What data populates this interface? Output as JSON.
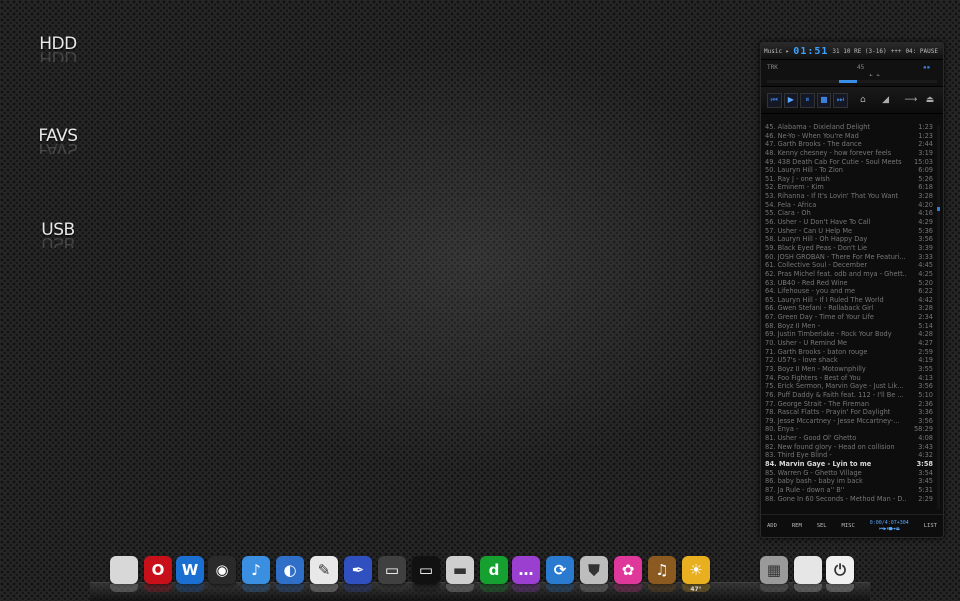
{
  "desktop": {
    "drives": [
      {
        "label": "HDD"
      },
      {
        "label": "FAVS"
      },
      {
        "label": "USB"
      }
    ]
  },
  "player": {
    "top_left": "Music ▸",
    "time": "01:51",
    "format": "31 10 RE (3-16)",
    "mode": "+++",
    "info_right": "04: PAUSE",
    "info_a": "TRK",
    "info_b": "45",
    "playlist": [
      {
        "title": "45. Alabama - Dixieland Delight",
        "time": "1:23"
      },
      {
        "title": "46. Ne-Yo - When You're Mad",
        "time": "1:23"
      },
      {
        "title": "47. Garth Brooks - The dance",
        "time": "2:44"
      },
      {
        "title": "48. Kenny chesney - how forever feels",
        "time": "3:19"
      },
      {
        "title": "49. 438 Death Cab For Cutie - Soul Meets",
        "time": "15:03"
      },
      {
        "title": "50. Lauryn Hill - To Zion",
        "time": "6:09"
      },
      {
        "title": "51. Ray J - one wish",
        "time": "5:26"
      },
      {
        "title": "52. Eminem - Kim",
        "time": "6:18"
      },
      {
        "title": "53. Rihanna - If It's Lovin' That You Want",
        "time": "3:28"
      },
      {
        "title": "54. Fela - Africa",
        "time": "4:20"
      },
      {
        "title": "55. Ciara - Oh",
        "time": "4:16"
      },
      {
        "title": "56. Usher - U Don't Have To Call",
        "time": "4:29"
      },
      {
        "title": "57. Usher - Can U Help Me",
        "time": "5:36"
      },
      {
        "title": "58. Lauryn Hill - Oh Happy Day",
        "time": "3:56"
      },
      {
        "title": "59. Black Eyed Peas - Don't Lie",
        "time": "3:39"
      },
      {
        "title": "60. JOSH GROBAN - There For Me Featuri...",
        "time": "3:33"
      },
      {
        "title": "61. Collective Soul - December",
        "time": "4:45"
      },
      {
        "title": "62. Pras Michel feat. odb and mya - Ghett...",
        "time": "4:25"
      },
      {
        "title": "63. UB40 - Red Red Wine",
        "time": "5:20"
      },
      {
        "title": "64. Lifehouse - you and me",
        "time": "6:22"
      },
      {
        "title": "65. Lauryn Hill - If I Ruled The World",
        "time": "4:42"
      },
      {
        "title": "66. Gwen Stefani - Rollaback Girl",
        "time": "3:28"
      },
      {
        "title": "67. Green Day - Time of Your Life",
        "time": "2:34"
      },
      {
        "title": "68. Boyz II Men -",
        "time": "5:14"
      },
      {
        "title": "69. Justin Timberlake - Rock Your Body",
        "time": "4:28"
      },
      {
        "title": "70. Usher - U Remind Me",
        "time": "4:27"
      },
      {
        "title": "71. Garth Brooks - baton rouge",
        "time": "2:59"
      },
      {
        "title": "72. U57's - love shack",
        "time": "4:19"
      },
      {
        "title": "73. Boyz II Men - Motownphilly",
        "time": "3:55"
      },
      {
        "title": "74. Foo Fighters - Best of You",
        "time": "4:13"
      },
      {
        "title": "75. Erick Sermon, Marvin Gaye - Just Lik...",
        "time": "3:56"
      },
      {
        "title": "76. Puff Daddy & Faith feat. 112 - I'll Be ...",
        "time": "5:10"
      },
      {
        "title": "77. George Strait - The Fireman",
        "time": "2:36"
      },
      {
        "title": "78. Rascal Flatts - Prayin' For Daylight",
        "time": "3:36"
      },
      {
        "title": "79. Jesse Mccartney - Jesse Mccartney-...",
        "time": "3:56"
      },
      {
        "title": "80. Enya -",
        "time": "58:29"
      },
      {
        "title": "81. Usher - Good Ol' Ghetto",
        "time": "4:08"
      },
      {
        "title": "82. New found glory - Head on collision",
        "time": "3:43"
      },
      {
        "title": "83. Third Eye Blind -",
        "time": "4:32"
      },
      {
        "title": "84. Marvin Gaye - Lyin to me",
        "time": "3:58"
      },
      {
        "title": "85. Warren G - Ghetto Village",
        "time": "3:54"
      },
      {
        "title": "86. baby bash - baby im back",
        "time": "3:45"
      },
      {
        "title": "87. Ja Rule - down a'' B''",
        "time": "5:31"
      },
      {
        "title": "88. Gone In 60 Seconds - Method Man - D...",
        "time": "2:29"
      }
    ],
    "active_index": 39,
    "bottom": {
      "add": "ADD",
      "rem": "REM",
      "sel": "SEL",
      "misc": "MISC",
      "counter": "0:00/4:07+304",
      "list": "LIST"
    }
  },
  "dock": {
    "weather_temp": "47°",
    "items": [
      {
        "name": "mouse-icon",
        "glyph": "",
        "bg": "#d8d8d8"
      },
      {
        "name": "opera-icon",
        "glyph": "O",
        "bg": "#c8101a"
      },
      {
        "name": "wordpad-icon",
        "glyph": "W",
        "bg": "#1b6fd0"
      },
      {
        "name": "camera-icon",
        "glyph": "◉",
        "bg": "#2a2a2a"
      },
      {
        "name": "itunes-icon",
        "glyph": "♪",
        "bg": "#3a8fe0"
      },
      {
        "name": "firefox-icon",
        "glyph": "◐",
        "bg": "#2f6fc8"
      },
      {
        "name": "feather-icon",
        "glyph": "✎",
        "bg": "#e8e8e8"
      },
      {
        "name": "pen-icon",
        "glyph": "✒",
        "bg": "#3050c0"
      },
      {
        "name": "monitor-icon",
        "glyph": "▭",
        "bg": "#404040"
      },
      {
        "name": "display-icon",
        "glyph": "▭",
        "bg": "#111111"
      },
      {
        "name": "drive-icon",
        "glyph": "▬",
        "bg": "#cfcfcf"
      },
      {
        "name": "dreamweaver-icon",
        "glyph": "d",
        "bg": "#16a030"
      },
      {
        "name": "pidgin-icon",
        "glyph": "…",
        "bg": "#9a3fcf"
      },
      {
        "name": "sync-icon",
        "glyph": "⟳",
        "bg": "#2a7ad0"
      },
      {
        "name": "shield-icon",
        "glyph": "⛊",
        "bg": "#bdbdbd"
      },
      {
        "name": "flower-icon",
        "glyph": "✿",
        "bg": "#e0389a"
      },
      {
        "name": "guitar-icon",
        "glyph": "♫",
        "bg": "#8a5a20"
      },
      {
        "name": "weather-icon",
        "glyph": "☀",
        "bg": "#e8b020"
      },
      {
        "name": "trash-icon",
        "glyph": "▦",
        "bg": "#9a9a9a"
      },
      {
        "name": "apple-icon",
        "glyph": "",
        "bg": "#e6e6e6"
      },
      {
        "name": "power-icon",
        "glyph": "⏻",
        "bg": "#f0f0f0"
      }
    ]
  }
}
